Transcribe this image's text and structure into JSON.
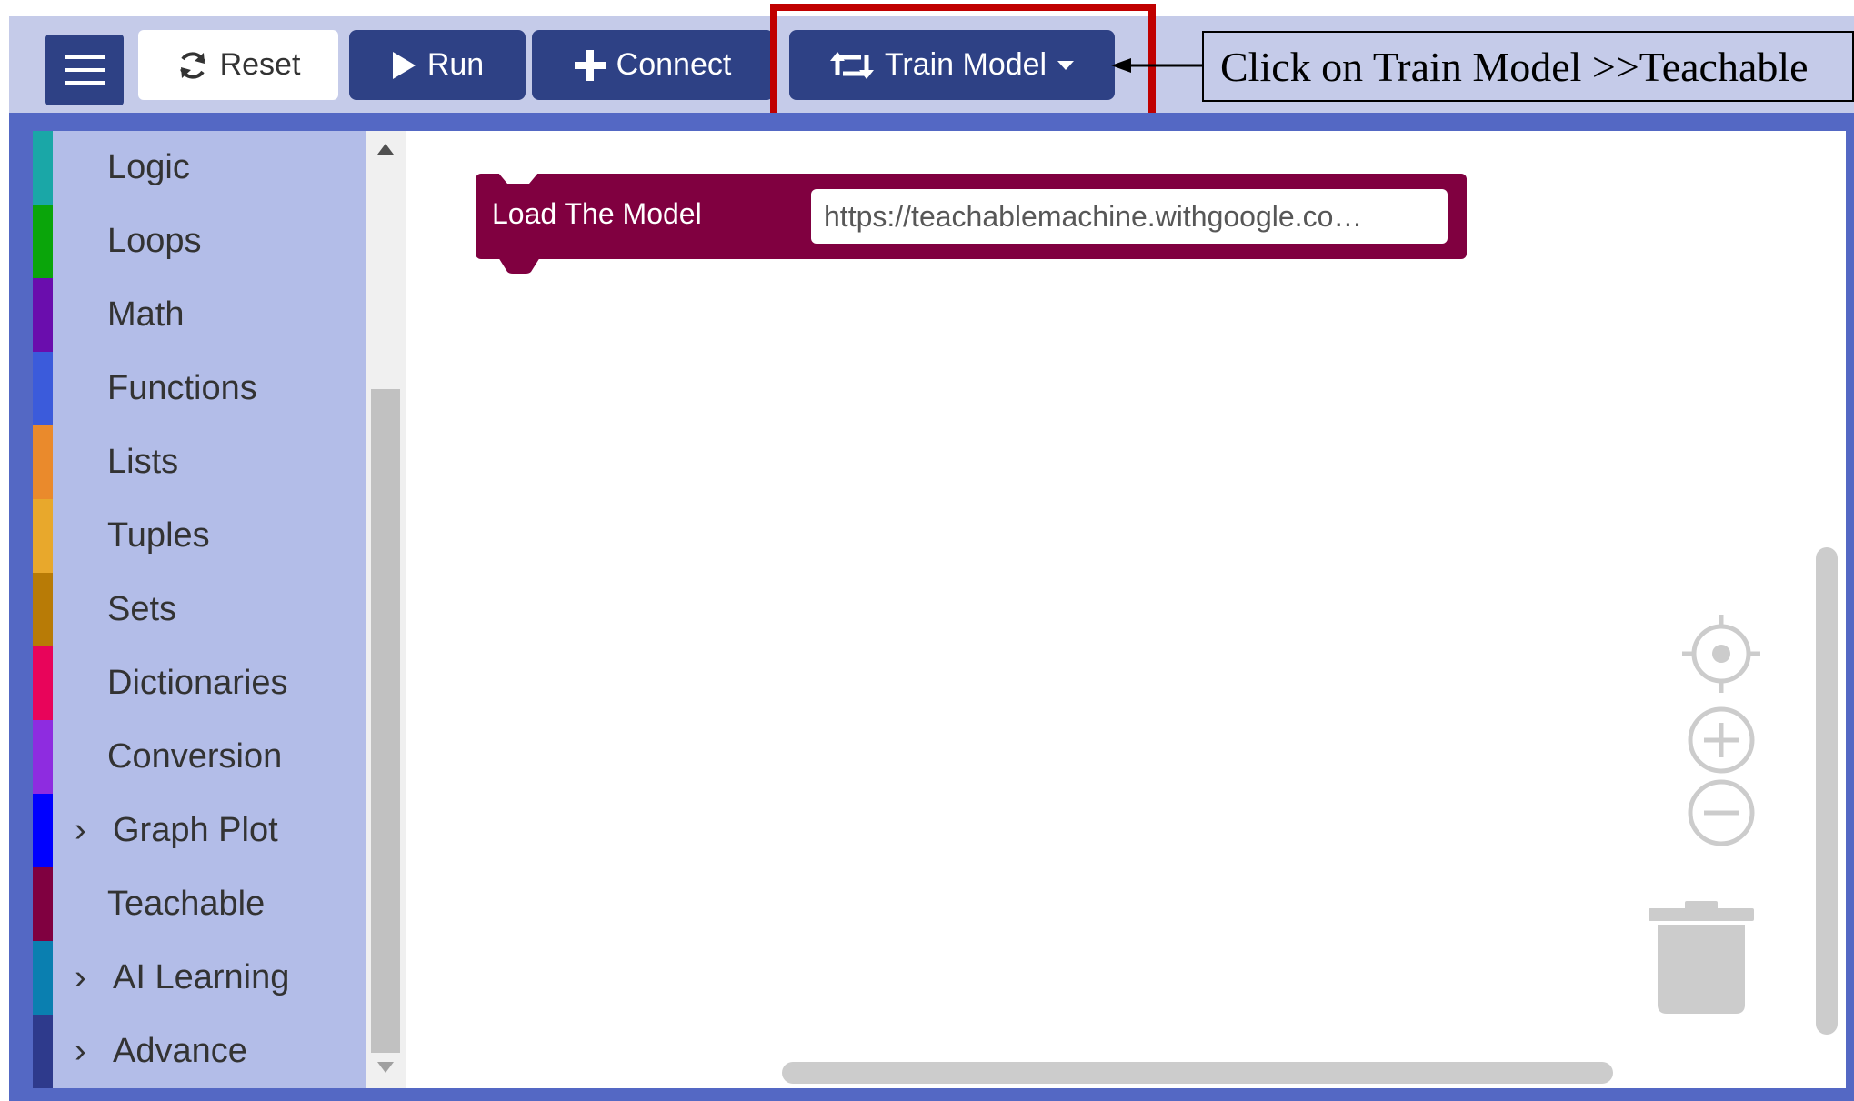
{
  "toolbar": {
    "reset_label": "Reset",
    "run_label": "Run",
    "connect_label": "Connect",
    "train_label": "Train Model"
  },
  "callout": {
    "text": "Click on Train Model >>Teachable"
  },
  "toolbox": {
    "categories": [
      {
        "label": "Logic",
        "color": "#1aa7a7",
        "expandable": false
      },
      {
        "label": "Loops",
        "color": "#0aa50a",
        "expandable": false
      },
      {
        "label": "Math",
        "color": "#6a0dad",
        "expandable": false
      },
      {
        "label": "Functions",
        "color": "#3b5bdb",
        "expandable": false
      },
      {
        "label": "Lists",
        "color": "#ea8a2c",
        "expandable": false
      },
      {
        "label": "Tuples",
        "color": "#e8a82c",
        "expandable": false
      },
      {
        "label": "Sets",
        "color": "#b87b06",
        "expandable": false
      },
      {
        "label": "Dictionaries",
        "color": "#e8045a",
        "expandable": false
      },
      {
        "label": "Conversion",
        "color": "#8e2ce0",
        "expandable": false
      },
      {
        "label": "Graph Plot",
        "color": "#0000ff",
        "expandable": true
      },
      {
        "label": "Teachable",
        "color": "#800040",
        "expandable": false
      },
      {
        "label": "AI Learning",
        "color": "#0a7fb0",
        "expandable": true
      },
      {
        "label": "Advance",
        "color": "#2e3a8c",
        "expandable": true
      }
    ]
  },
  "block": {
    "label": "Load The Model",
    "url_value": "https://teachablemachine.withgoogle.co…",
    "color": "#800040"
  },
  "colors": {
    "toolbar_bg": "#c5cbe9",
    "button_bg": "#2e4185",
    "highlight": "#c00000"
  }
}
